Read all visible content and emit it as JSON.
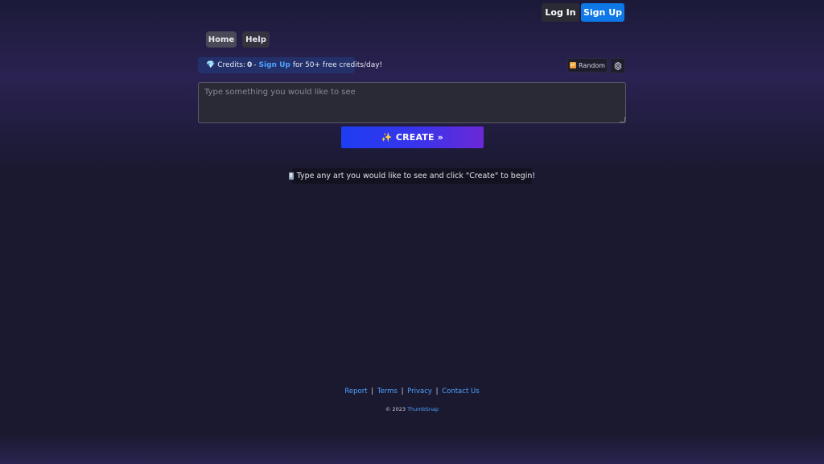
{
  "header": {
    "login_label": "Log In",
    "signup_label": "Sign Up"
  },
  "nav": {
    "items": [
      {
        "label": "Home"
      },
      {
        "label": "Help"
      }
    ]
  },
  "credits": {
    "icon": "diamond-icon",
    "prefix": "Credits:",
    "count": "0",
    "dash": "-",
    "signup_link": "Sign Up",
    "suffix": "for 50+ free credits/day!"
  },
  "toolbar": {
    "random_icon": "shuffle-icon",
    "random_label": "Random",
    "settings_icon": "gear-icon"
  },
  "prompt": {
    "placeholder": "Type something you would like to see",
    "value": ""
  },
  "create": {
    "label": "✨ CREATE »"
  },
  "hint": {
    "icon": "up-arrow-icon",
    "text": "Type any art you would like to see and click \"Create\" to begin!"
  },
  "footer": {
    "links": [
      "Report",
      "Terms",
      "Privacy",
      "Contact Us"
    ],
    "separator": "|",
    "copyright_prefix": "© 2023",
    "brand": "ThumbSnap"
  },
  "colors": {
    "accent": "#0d78e6",
    "link": "#4ea3ff",
    "background": "#1a1930"
  }
}
